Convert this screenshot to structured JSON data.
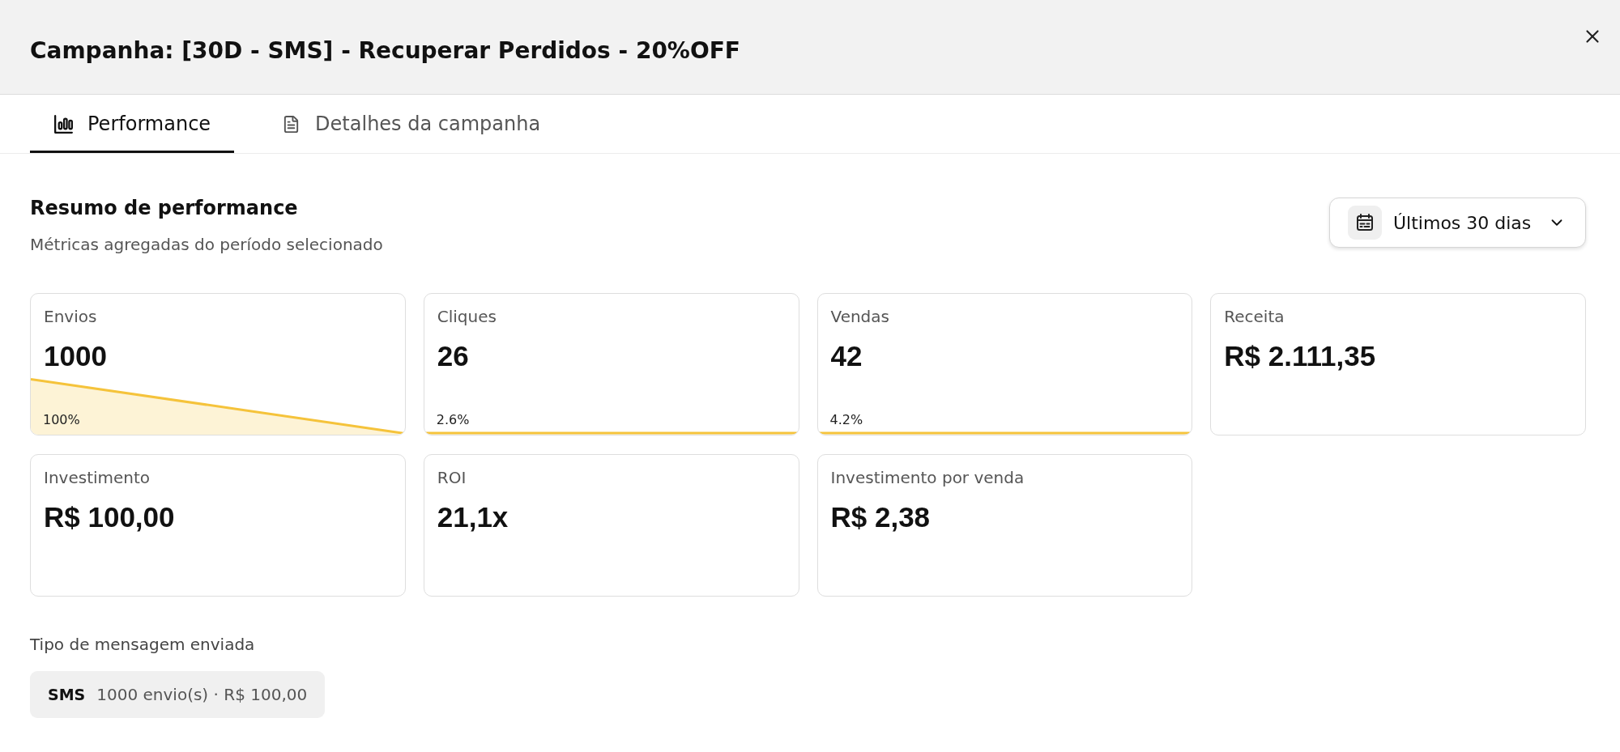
{
  "dialog": {
    "title": "Campanha: [30D - SMS] - Recuperar Perdidos - 20%OFF"
  },
  "tabs": [
    {
      "label": "Performance",
      "selected": true
    },
    {
      "label": "Detalhes da campanha",
      "selected": false
    }
  ],
  "summary": {
    "title": "Resumo de performance",
    "subtitle": "Métricas agregadas do período selecionado",
    "period": "Últimos 30 dias"
  },
  "cards": [
    {
      "kind": "decline",
      "label": "Envios",
      "value": "1000",
      "percentage": "100%"
    },
    {
      "kind": "flat",
      "label": "Cliques",
      "value": "26",
      "percentage": "2.6%"
    },
    {
      "kind": "flat",
      "label": "Vendas",
      "value": "42",
      "percentage": "4.2%"
    },
    {
      "kind": "plain",
      "label": "Receita",
      "value": "R$ 2.111,35"
    },
    {
      "kind": "plain",
      "label": "Investimento",
      "value": "R$ 100,00"
    },
    {
      "kind": "plain",
      "label": "ROI",
      "value": "21,1x"
    },
    {
      "kind": "plain",
      "label": "Investimento por venda",
      "value": "R$ 2,38"
    }
  ],
  "message_types": {
    "title": "Tipo de mensagem enviada",
    "items": [
      {
        "channel": "SMS",
        "summary": "1000 envio(s) · R$ 100,00"
      }
    ]
  }
}
